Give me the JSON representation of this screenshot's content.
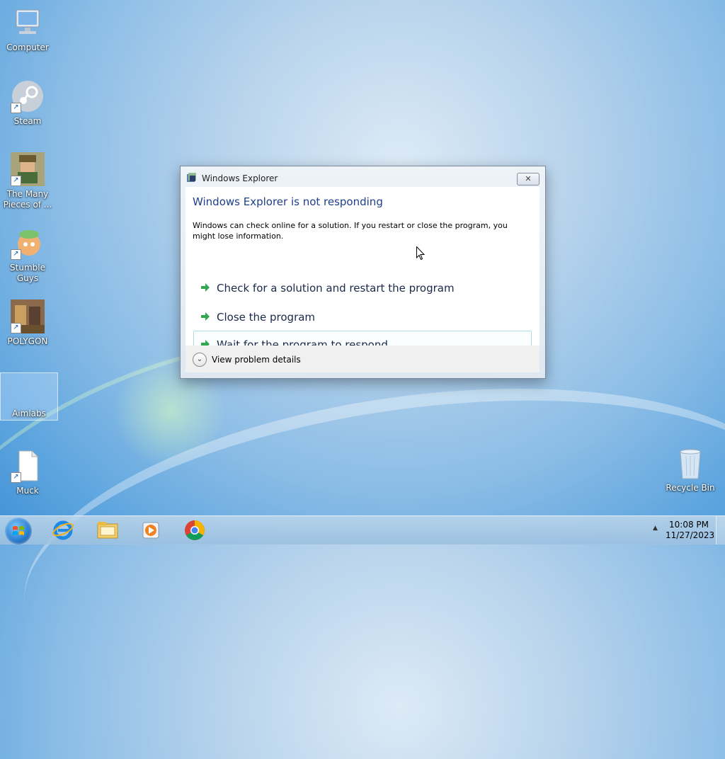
{
  "desktop": {
    "icons": [
      {
        "label": "Computer"
      },
      {
        "label": "Steam"
      },
      {
        "label": "The Many Pieces of ..."
      },
      {
        "label": "Stumble Guys"
      },
      {
        "label": "POLYGON"
      },
      {
        "label": "Aimlabs"
      },
      {
        "label": "Muck"
      },
      {
        "label": "Recycle Bin"
      }
    ]
  },
  "dialog": {
    "title": "Windows Explorer",
    "close_glyph": "✕",
    "heading": "Windows Explorer is not responding",
    "description": "Windows can check online for a solution. If you restart or close the program, you might lose information.",
    "options": [
      {
        "label": "Check for a solution and restart the program"
      },
      {
        "label": "Close the program"
      },
      {
        "label": "Wait for the program to respond"
      }
    ],
    "details_label": "View problem details",
    "details_glyph": "⌄"
  },
  "taskbar": {
    "apps": [
      "internet-explorer-icon",
      "file-explorer-icon",
      "media-player-icon",
      "chrome-icon"
    ],
    "tray_arrow": "▲",
    "time": "10:08 PM",
    "date": "11/27/2023"
  },
  "colors": {
    "heading": "#1e3f8a",
    "arrow_green": "#2fa84f",
    "hover_border": "#b0e0e6"
  }
}
